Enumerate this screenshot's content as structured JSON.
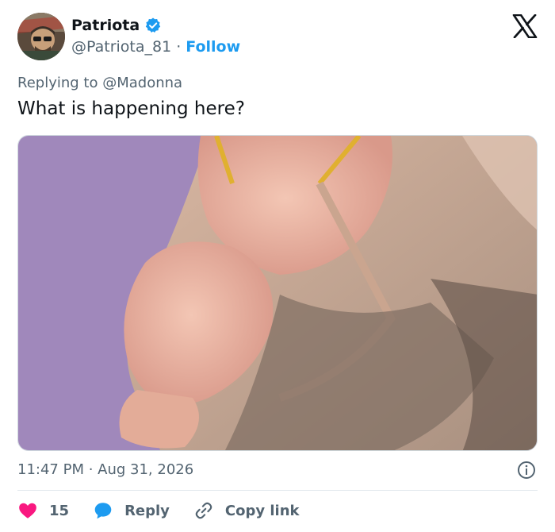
{
  "author": {
    "name": "Patriota",
    "handle": "@Patriota_81",
    "separator": "·",
    "follow_label": "Follow"
  },
  "reply_context": {
    "prefix": "Replying to",
    "mention": "@Madonna"
  },
  "tweet": {
    "text": "What is happening here?",
    "timestamp": "11:47 PM · Aug 31, 2026"
  },
  "actions": {
    "likes": "15",
    "reply_label": "Reply",
    "copy_link_label": "Copy link"
  },
  "icons": {
    "verified": "verified-badge-icon",
    "logo": "x-logo-icon",
    "info": "info-icon",
    "like": "heart-icon",
    "reply": "speech-bubble-icon",
    "link": "link-icon"
  },
  "colors": {
    "accent": "#1d9bf0",
    "like": "#f91880",
    "text_secondary": "#536471"
  }
}
